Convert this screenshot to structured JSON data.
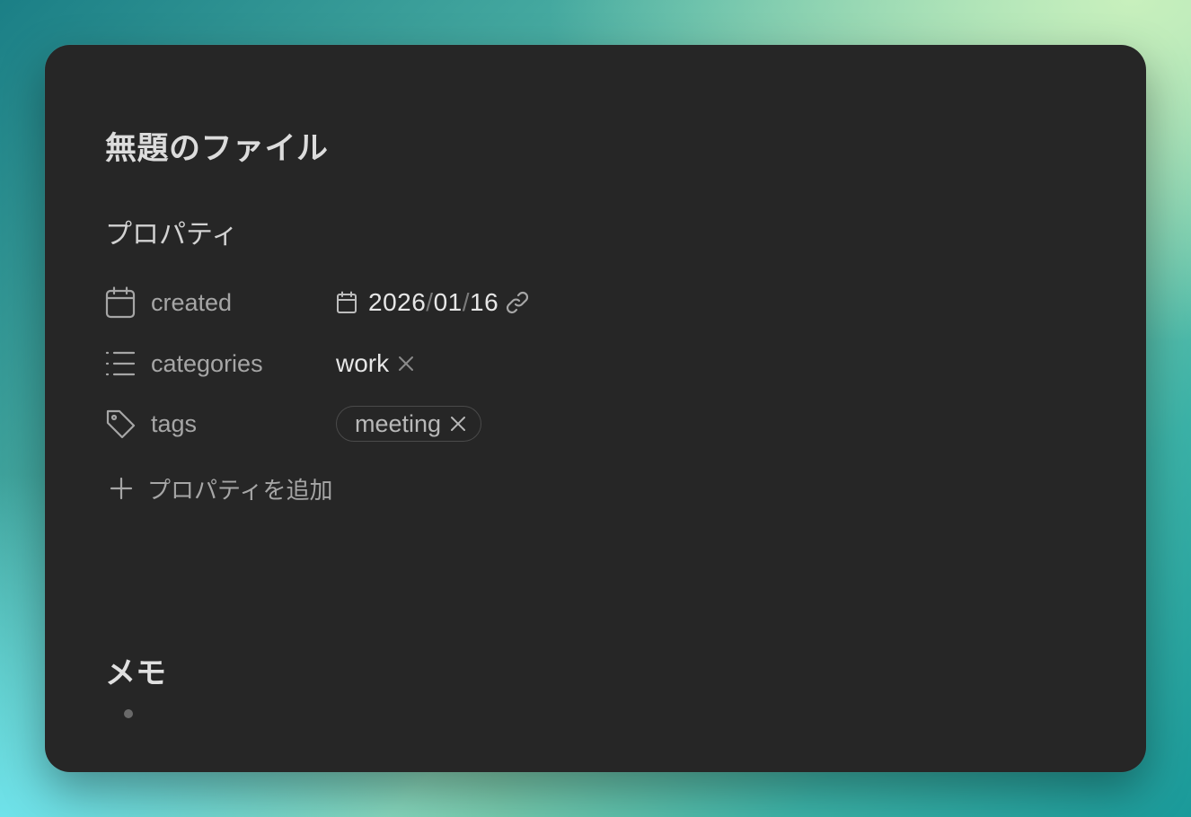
{
  "note": {
    "title": "無題のファイル",
    "properties_heading": "プロパティ",
    "properties": [
      {
        "icon": "calendar-icon",
        "label": "created",
        "type": "date",
        "value": {
          "year": "2026",
          "month": "01",
          "day": "16",
          "separator": "/"
        }
      },
      {
        "icon": "list-icon",
        "label": "categories",
        "type": "list",
        "values": [
          "work"
        ]
      },
      {
        "icon": "tag-icon",
        "label": "tags",
        "type": "tags",
        "values": [
          "meeting"
        ]
      }
    ],
    "add_property_label": "プロパティを追加",
    "memo_heading": "メモ",
    "memo_items": [
      ""
    ]
  },
  "colors": {
    "window_bg": "#262626",
    "text_primary": "#e6e6e6",
    "text_muted": "#a6a6a6",
    "pill_border": "#4a4a4a"
  }
}
